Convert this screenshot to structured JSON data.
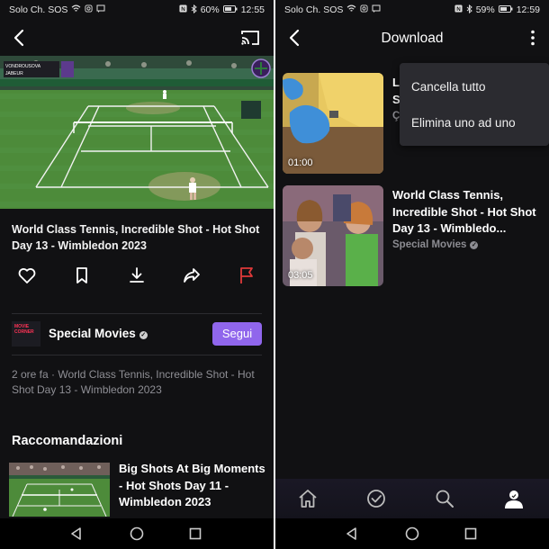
{
  "left": {
    "status": {
      "carrier": "Solo Ch. SOS",
      "battery": "60%",
      "time": "12:55"
    },
    "scoreboard": {
      "player1": "VONDROUSOVA",
      "player2": "JABEUR"
    },
    "video_title": "World Class Tennis, Incredible Shot  - Hot Shot Day 13 - Wimbledon 2023",
    "actions": [
      "heart-icon",
      "bookmark-icon",
      "download-icon",
      "share-icon",
      "flag-icon"
    ],
    "channel": {
      "logo_text": "MOVIE CORNER",
      "name": "Special Movies",
      "follow_label": "Segui"
    },
    "meta_text": "2 ore fa · World Class Tennis, Incredible Shot - Hot Shot Day 13 - Wimbledon 2023",
    "recommendations_heading": "Raccomandazioni",
    "recommendation": {
      "title": "Big Shots At Big Moments - Hot Shots Day 11 - Wimbledon 2023"
    }
  },
  "right": {
    "status": {
      "carrier": "Solo Ch. SOS",
      "battery": "59%",
      "time": "12:59"
    },
    "page_title": "Download",
    "downloads": [
      {
        "title_partial": "L",
        "title_partial2": "S",
        "channel_partial": "Ç",
        "duration": "01:00"
      },
      {
        "title": "World Class Tennis, Incredible Shot  - Hot Shot Day 13 - Wimbledo...",
        "channel": "Special Movies",
        "duration": "03:05"
      }
    ],
    "menu": {
      "items": [
        "Cancella tutto",
        "Elimina uno ad uno"
      ]
    },
    "bottom_nav": [
      "home-icon",
      "check-circle-icon",
      "search-icon",
      "profile-icon"
    ]
  },
  "colors": {
    "background": "#111113",
    "accent": "#9066ec",
    "flag": "#e03a3a",
    "court": "#4f8a3b"
  }
}
